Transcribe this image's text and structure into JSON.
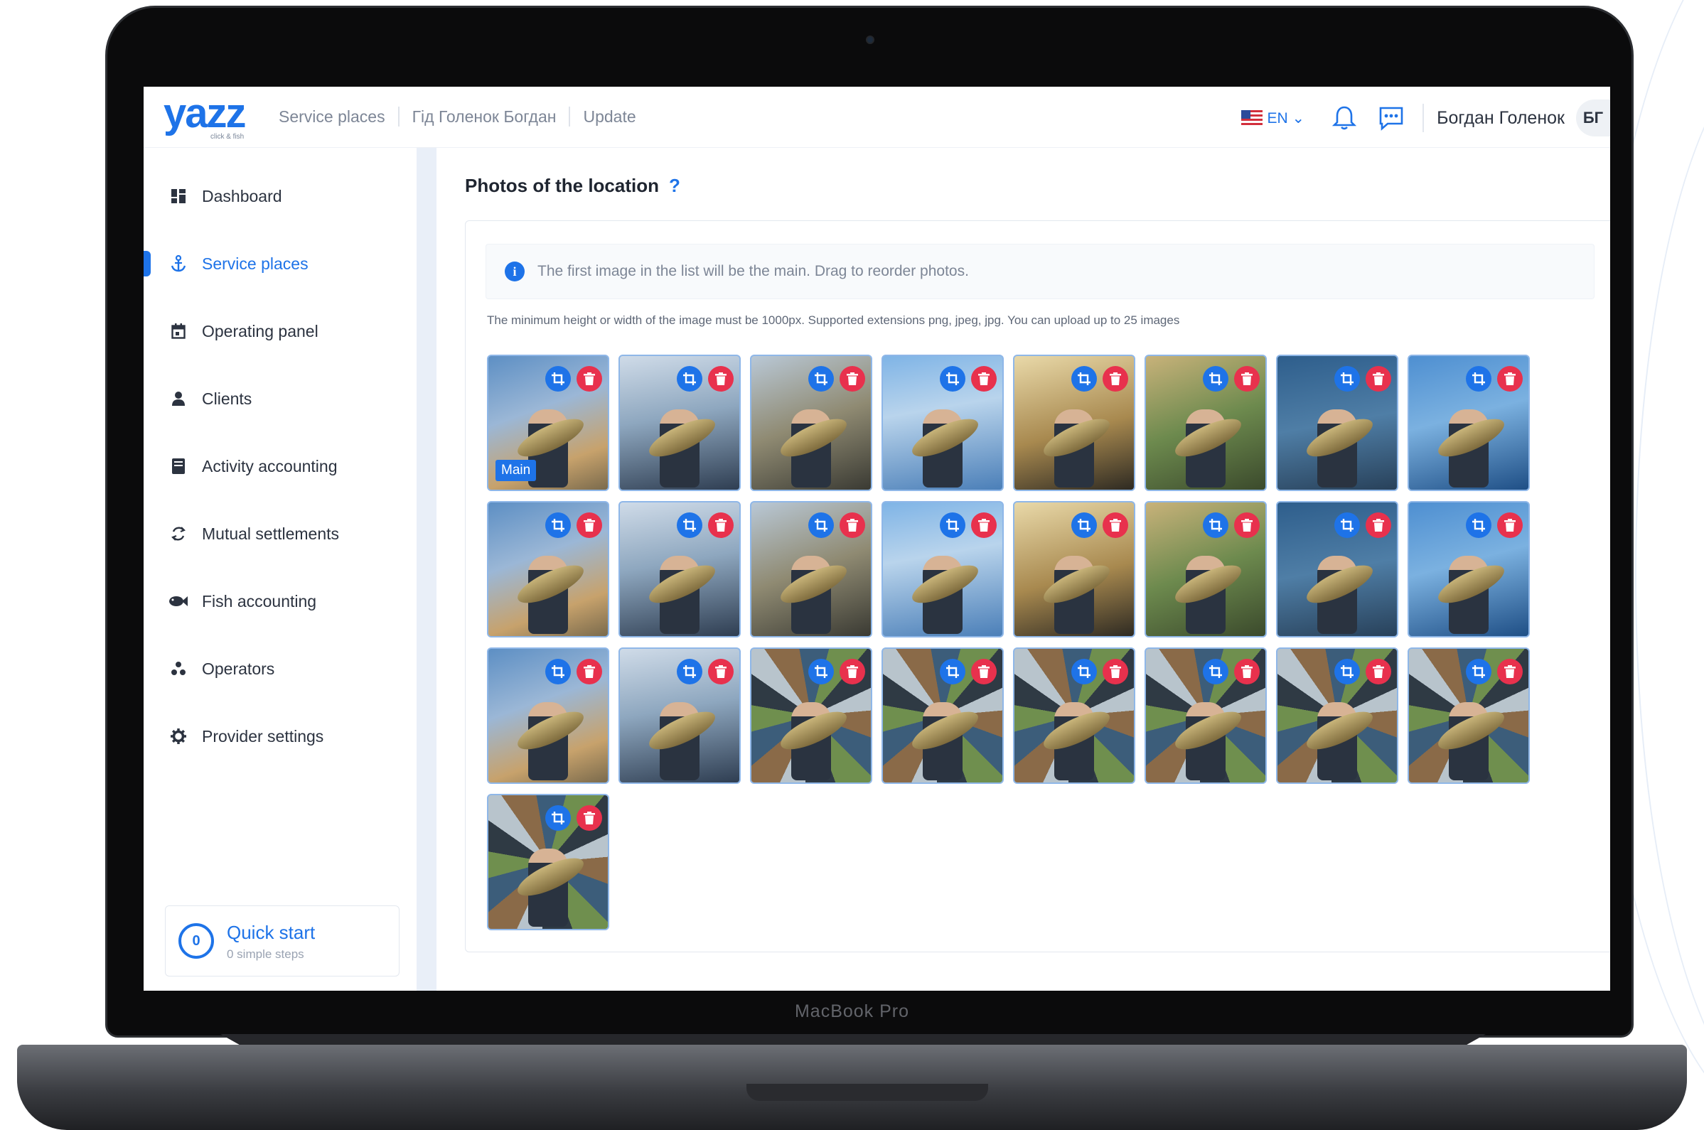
{
  "app": {
    "logo_text": "yazz",
    "logo_subtitle": "click & fish",
    "device_label": "MacBook Pro"
  },
  "topbar": {
    "breadcrumbs": [
      "Service places",
      "Гід Голенок Богдан",
      "Update"
    ],
    "language": "EN",
    "user_name": "Богдан Голенок",
    "user_initials": "БГ"
  },
  "sidebar": {
    "items": [
      {
        "label": "Dashboard",
        "icon": "dashboard-icon",
        "active": false
      },
      {
        "label": "Service places",
        "icon": "anchor-icon",
        "active": true
      },
      {
        "label": "Operating panel",
        "icon": "calendar-icon",
        "active": false
      },
      {
        "label": "Clients",
        "icon": "person-icon",
        "active": false
      },
      {
        "label": "Activity accounting",
        "icon": "ledger-icon",
        "active": false
      },
      {
        "label": "Mutual settlements",
        "icon": "exchange-icon",
        "active": false
      },
      {
        "label": "Fish accounting",
        "icon": "fish-icon",
        "active": false
      },
      {
        "label": "Operators",
        "icon": "people-icon",
        "active": false
      },
      {
        "label": "Provider settings",
        "icon": "gear-icon",
        "active": false
      }
    ],
    "quick_start": {
      "progress": "0",
      "title": "Quick start",
      "subtitle": "0 simple steps"
    }
  },
  "main": {
    "section_title": "Photos of the location",
    "help_mark": "?",
    "info_note": "The first image in the list will be the main. Drag to reorder photos.",
    "requirements": "The minimum height or width of the image must be 1000px. Supported extensions png, jpeg, jpg. You can upload up to 25 images",
    "main_badge": "Main",
    "photo_count": 25
  },
  "colors": {
    "accent": "#1e73e8",
    "delete": "#e8314d",
    "text": "#2c3340",
    "muted": "#7d8696"
  }
}
